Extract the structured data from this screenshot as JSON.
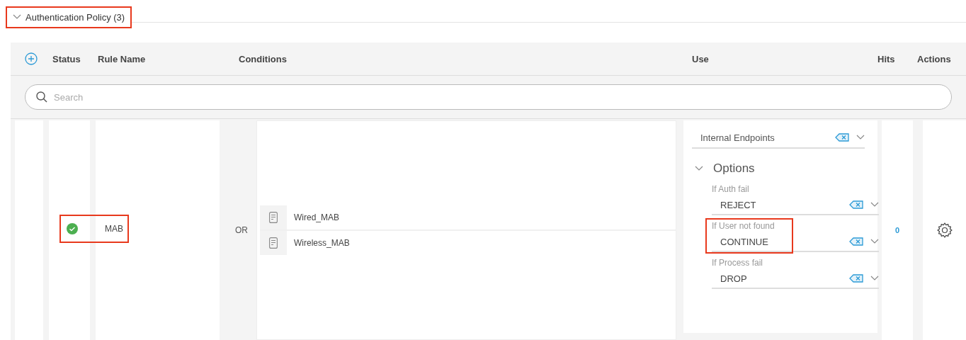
{
  "section": {
    "title": "Authentication Policy (3)",
    "expanded": true,
    "highlighted": true
  },
  "table": {
    "columns": [
      "Status",
      "Rule Name",
      "Conditions",
      "Use",
      "Hits",
      "Actions"
    ],
    "search": {
      "placeholder": "Search"
    },
    "rows": [
      {
        "enabled": true,
        "name": "MAB",
        "highlighted": true,
        "operator": "OR",
        "conditions": [
          "Wired_MAB",
          "Wireless_MAB"
        ],
        "use": {
          "source": "Internal Endpoints",
          "options_title": "Options",
          "options_expanded": true,
          "options": [
            {
              "label": "If Auth fail",
              "value": "REJECT",
              "highlighted": false
            },
            {
              "label": "If User not found",
              "value": "CONTINUE",
              "highlighted": true
            },
            {
              "label": "If Process fail",
              "value": "DROP",
              "highlighted": false
            }
          ]
        },
        "hits": "0"
      }
    ]
  }
}
